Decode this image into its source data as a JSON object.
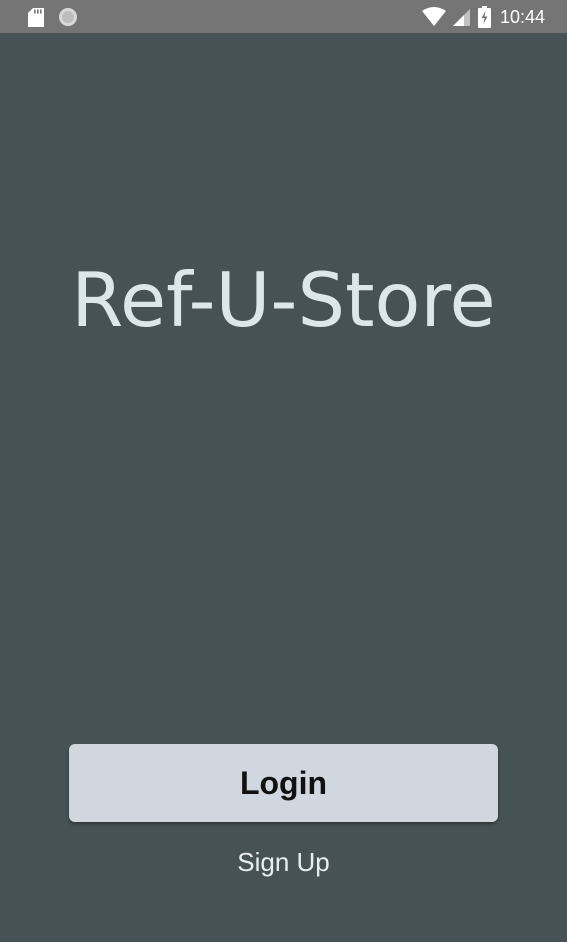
{
  "status_bar": {
    "time": "10:44",
    "icons": [
      "sd-card-icon",
      "circle-icon",
      "wifi-icon",
      "signal-icon",
      "battery-charging-icon"
    ]
  },
  "app": {
    "title": "Ref-U-Store"
  },
  "actions": {
    "login_label": "Login",
    "signup_label": "Sign Up"
  },
  "colors": {
    "background": "#475256",
    "status_bar": "#757575",
    "button": "#d0d7de",
    "title_text": "#dde6e9"
  }
}
